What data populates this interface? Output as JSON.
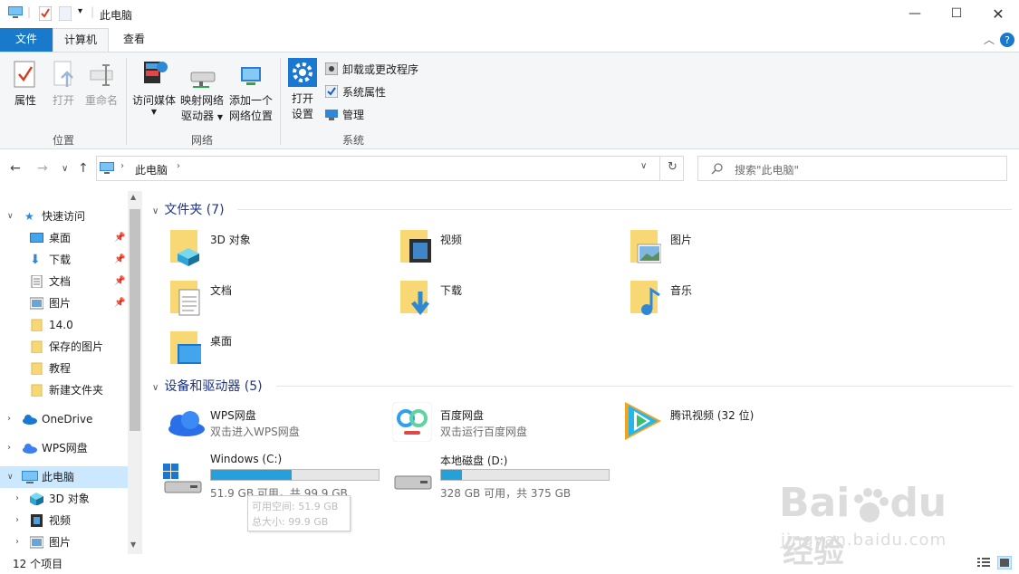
{
  "window": {
    "title": "此电脑"
  },
  "tabs": {
    "file": "文件",
    "computer": "计算机",
    "view": "查看"
  },
  "ribbon": {
    "location": {
      "label": "位置",
      "properties": "属性",
      "open": "打开",
      "rename": "重命名"
    },
    "network": {
      "label": "网络",
      "media": "访问媒体",
      "map_line1": "映射网络",
      "map_line2": "驱动器",
      "add_line1": "添加一个",
      "add_line2": "网络位置"
    },
    "system": {
      "label": "系统",
      "settings_line1": "打开",
      "settings_line2": "设置",
      "uninstall": "卸载或更改程序",
      "sysprops": "系统属性",
      "manage": "管理"
    }
  },
  "address": {
    "path": "此电脑"
  },
  "search": {
    "placeholder": "搜索\"此电脑\""
  },
  "nav": {
    "quick_access": "快速访问",
    "quick_items": [
      "桌面",
      "下载",
      "文档",
      "图片",
      "14.0",
      "保存的图片",
      "教程",
      "新建文件夹"
    ],
    "onedrive": "OneDrive",
    "wps": "WPS网盘",
    "this_pc": "此电脑",
    "pc_items": [
      "3D 对象",
      "视频",
      "图片"
    ]
  },
  "content": {
    "folders_header": "文件夹 (7)",
    "folders": [
      "3D 对象",
      "视频",
      "图片",
      "文档",
      "下载",
      "音乐",
      "桌面"
    ],
    "devices_header": "设备和驱动器 (5)",
    "wps": {
      "name": "WPS网盘",
      "sub": "双击进入WPS网盘"
    },
    "baidu": {
      "name": "百度网盘",
      "sub": "双击运行百度网盘"
    },
    "tencent": {
      "name": "腾讯视频 (32 位)"
    },
    "drive_c": {
      "name": "Windows (C:)",
      "sub": "51.9 GB 可用，共 99.9 GB",
      "used_fraction": 0.48
    },
    "drive_d": {
      "name": "本地磁盘 (D:)",
      "sub": "328 GB 可用，共 375 GB",
      "used_fraction": 0.125
    },
    "tooltip_line1": "可用空间: 51.9 GB",
    "tooltip_line2": "总大小: 99.9 GB"
  },
  "status": {
    "items": "12 个项目"
  },
  "watermark": {
    "brand": "Bai",
    "brand2": "du",
    "cn": "经验",
    "url": "jingyan.baidu.com"
  },
  "colors": {
    "accent": "#1979ca",
    "bar_fill": "#26a0da",
    "folder": "#f8d775",
    "selected": "#cce8ff"
  }
}
